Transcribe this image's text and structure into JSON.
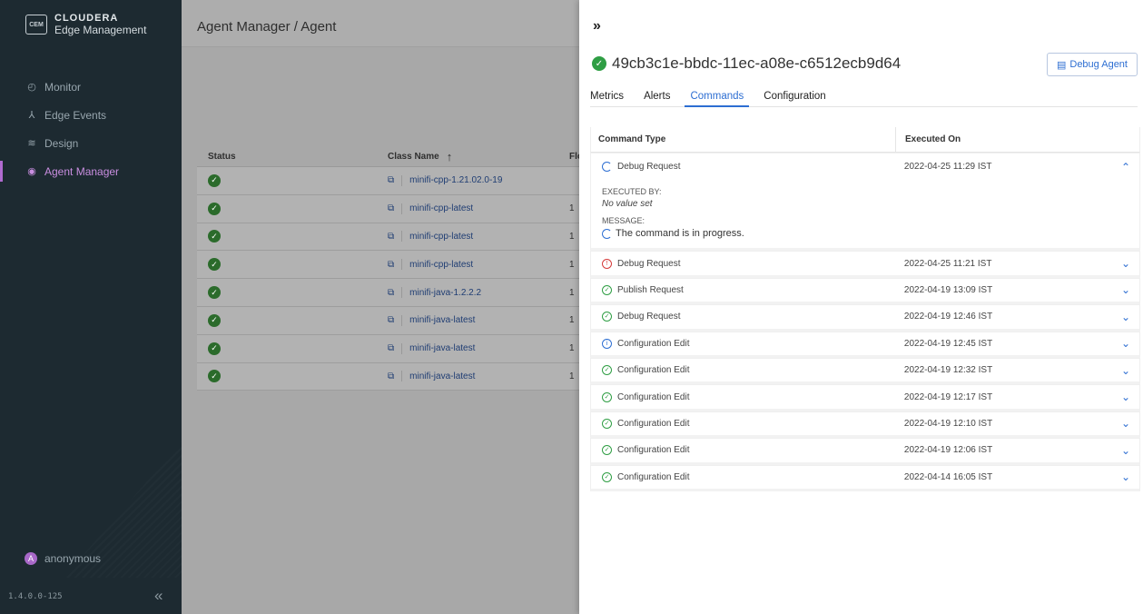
{
  "sidebar": {
    "brand_mark": "CEM",
    "brand_name": "CLOUDERA",
    "brand_sub": "Edge Management",
    "items": [
      {
        "label": "Monitor",
        "icon": "gauge-icon"
      },
      {
        "label": "Edge Events",
        "icon": "edge-events-icon"
      },
      {
        "label": "Design",
        "icon": "design-icon"
      },
      {
        "label": "Agent Manager",
        "icon": "agent-manager-icon"
      }
    ],
    "user": "anonymous",
    "user_initial": "A",
    "version": "1.4.0.0-125",
    "collapse_glyph": "«"
  },
  "main": {
    "breadcrumb": "Agent Manager / Agent",
    "columns": {
      "status": "Status",
      "class_name": "Class Name",
      "flow": "Flo"
    },
    "rows": [
      {
        "class": "minifi-cpp-1.21.02.0-19",
        "flow": ""
      },
      {
        "class": "minifi-cpp-latest",
        "flow": "1"
      },
      {
        "class": "minifi-cpp-latest",
        "flow": "1"
      },
      {
        "class": "minifi-cpp-latest",
        "flow": "1"
      },
      {
        "class": "minifi-java-1.2.2.2",
        "flow": "1"
      },
      {
        "class": "minifi-java-latest",
        "flow": "1"
      },
      {
        "class": "minifi-java-latest",
        "flow": "1"
      },
      {
        "class": "minifi-java-latest",
        "flow": "1"
      }
    ]
  },
  "panel": {
    "toggle": "»",
    "agent_id": "49cb3c1e-bbdc-11ec-a08e-c6512ecb9d64",
    "debug_button": "Debug Agent",
    "tabs": [
      "Metrics",
      "Alerts",
      "Commands",
      "Configuration"
    ],
    "active_tab": "Commands",
    "cmd_columns": {
      "type": "Command Type",
      "executed": "Executed On"
    },
    "expanded": {
      "type": "Debug Request",
      "status": "progress",
      "executed_on": "2022-04-25 11:29 IST",
      "executed_by_label": "EXECUTED BY:",
      "executed_by_value": "No value set",
      "message_label": "MESSAGE:",
      "message_value": "The command is in progress."
    },
    "commands": [
      {
        "type": "Debug Request",
        "status": "error",
        "executed_on": "2022-04-25 11:21 IST"
      },
      {
        "type": "Publish Request",
        "status": "success",
        "executed_on": "2022-04-19 13:09 IST"
      },
      {
        "type": "Debug Request",
        "status": "success",
        "executed_on": "2022-04-19 12:46 IST"
      },
      {
        "type": "Configuration Edit",
        "status": "info",
        "executed_on": "2022-04-19 12:45 IST"
      },
      {
        "type": "Configuration Edit",
        "status": "success",
        "executed_on": "2022-04-19 12:32 IST"
      },
      {
        "type": "Configuration Edit",
        "status": "success",
        "executed_on": "2022-04-19 12:17 IST"
      },
      {
        "type": "Configuration Edit",
        "status": "success",
        "executed_on": "2022-04-19 12:10 IST"
      },
      {
        "type": "Configuration Edit",
        "status": "success",
        "executed_on": "2022-04-19 12:06 IST"
      },
      {
        "type": "Configuration Edit",
        "status": "success",
        "executed_on": "2022-04-14 16:05 IST"
      }
    ]
  },
  "colors": {
    "accent": "#2d6ed2",
    "success": "#2f9e44",
    "error": "#d63a3a",
    "sidebar_bg": "#1d2a31",
    "nav_active": "#c98ee0"
  }
}
